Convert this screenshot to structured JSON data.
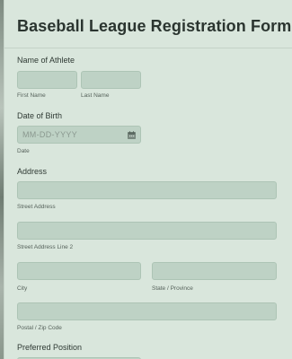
{
  "form": {
    "title": "Baseball League Registration Form"
  },
  "athlete_name": {
    "label": "Name of Athlete",
    "first_sublabel": "First Name",
    "last_sublabel": "Last Name",
    "first_value": "",
    "last_value": ""
  },
  "date_of_birth": {
    "label": "Date of Birth",
    "placeholder": "MM-DD-YYYY",
    "sublabel": "Date",
    "icon": "calendar-icon"
  },
  "address": {
    "label": "Address",
    "street_sublabel": "Street Address",
    "street2_sublabel": "Street Address Line 2",
    "city_sublabel": "City",
    "state_sublabel": "State / Province",
    "postal_sublabel": "Postal / Zip Code"
  },
  "preferred_position": {
    "label": "Preferred Position"
  },
  "colors": {
    "background": "#d9e6dc",
    "input_fill": "#bed2c5",
    "title_text": "#2b3530"
  }
}
